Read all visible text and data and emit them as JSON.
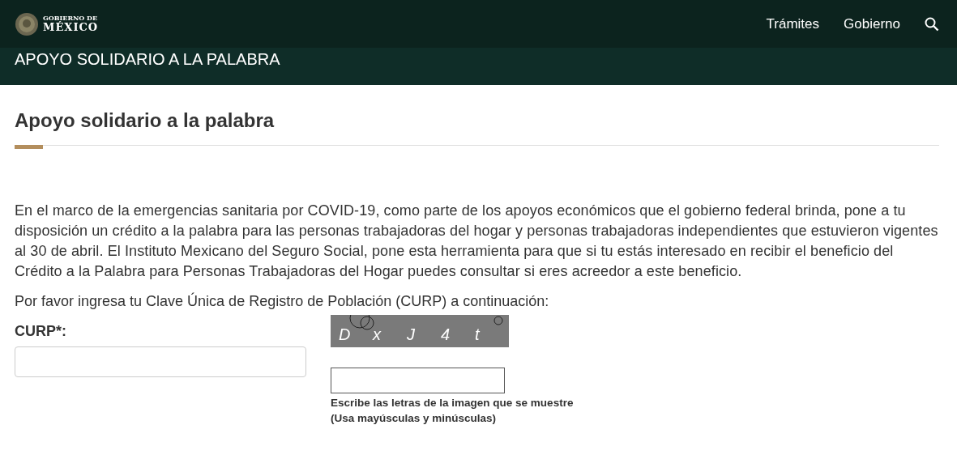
{
  "header": {
    "logo": {
      "line1": "GOBIERNO DE",
      "line2": "MÉXICO"
    },
    "nav": [
      "Trámites",
      "Gobierno"
    ]
  },
  "banner": {
    "title": "APOYO SOLIDARIO A LA PALABRA"
  },
  "page": {
    "heading": "Apoyo solidario a la palabra",
    "intro": "En el marco de la emergencias sanitaria por COVID-19, como parte de los apoyos económicos que el gobierno federal brinda, pone a tu disposición un crédito a la palabra para las personas trabajadoras del hogar y personas trabajadoras independientes que estuvieron vigentes al 30 de abril. El Instituto Mexicano del Seguro Social, pone esta herramienta para que si tu estás interesado en recibir el beneficio del Crédito a la Palabra para Personas Trabajadoras del Hogar puedes consultar si eres acreedor a este beneficio.",
    "instruction": "Por favor ingresa tu Clave Única de Registro de Población (CURP) a continuación:"
  },
  "form": {
    "curp_label": "CURP*:",
    "captcha": {
      "characters": [
        "D",
        "x",
        "J",
        "4",
        "t"
      ],
      "help_lines": [
        "Escribe las letras de la imagen que se muestre",
        "(Usa mayúsculas y minúsculas)"
      ]
    }
  }
}
